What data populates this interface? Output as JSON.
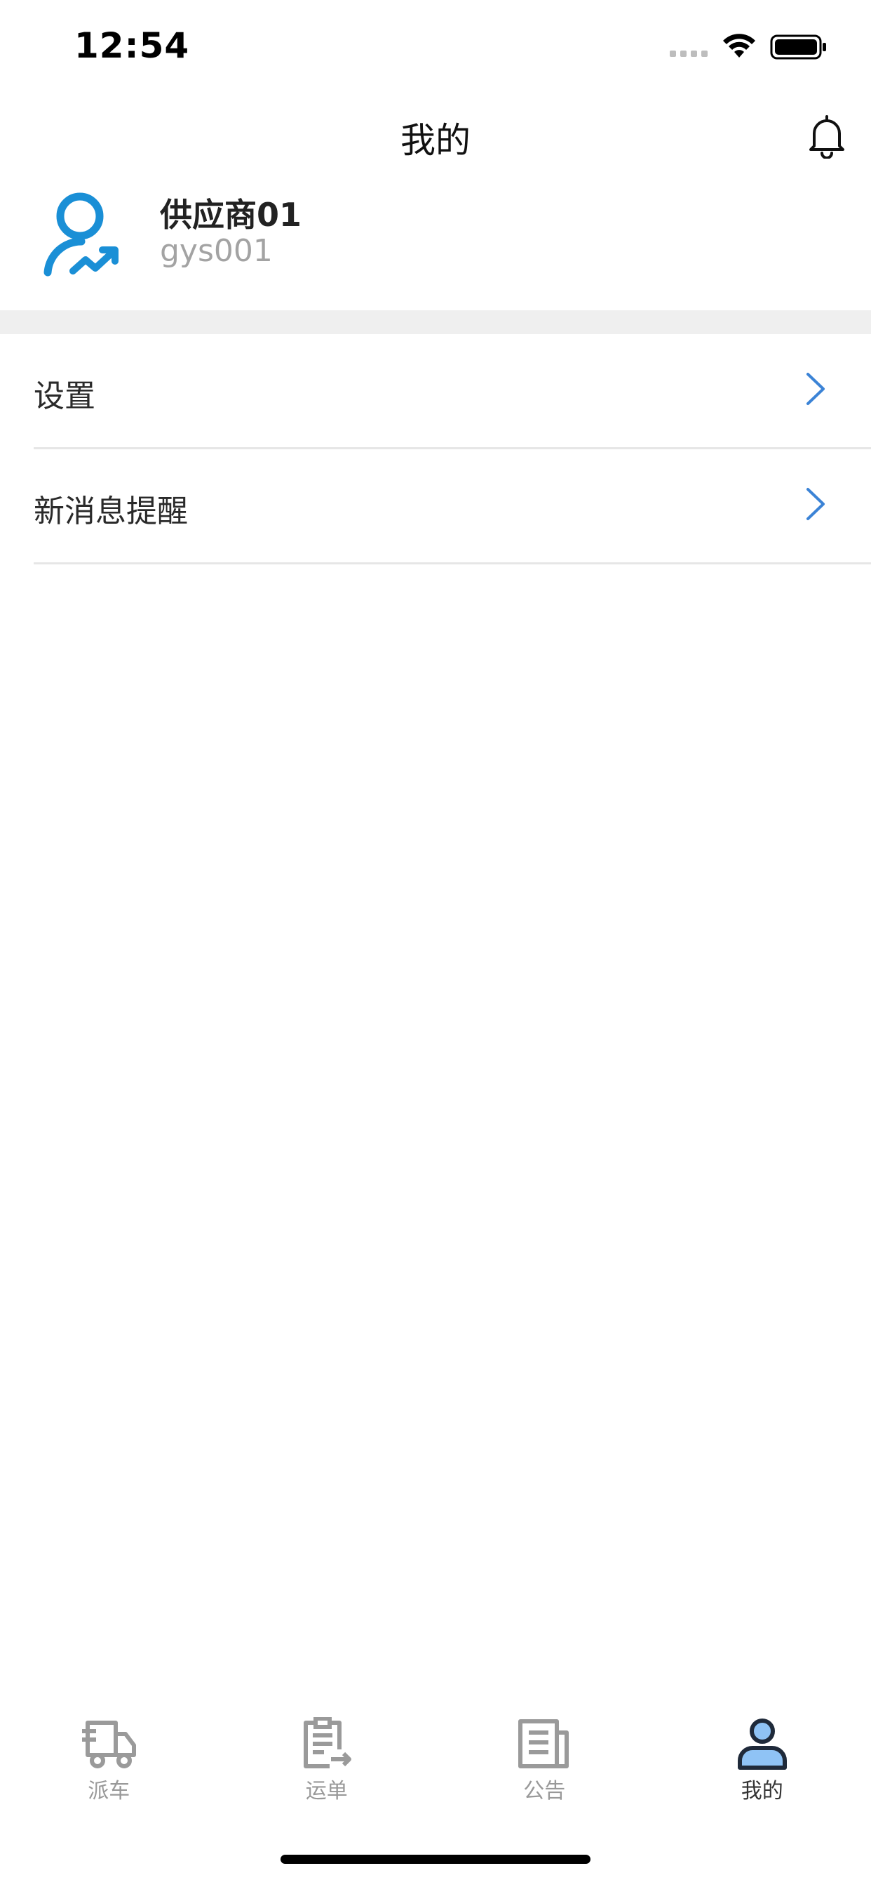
{
  "status_bar": {
    "time": "12:54"
  },
  "header": {
    "title": "我的"
  },
  "profile": {
    "name": "供应商01",
    "account": "gys001"
  },
  "menu": {
    "items": [
      {
        "label": "设置"
      },
      {
        "label": "新消息提醒"
      }
    ]
  },
  "tab_bar": {
    "tabs": [
      {
        "label": "派车",
        "icon": "truck-icon",
        "active": false
      },
      {
        "label": "运单",
        "icon": "waybill-icon",
        "active": false
      },
      {
        "label": "公告",
        "icon": "notice-icon",
        "active": false
      },
      {
        "label": "我的",
        "icon": "user-icon",
        "active": true
      }
    ]
  },
  "colors": {
    "accent": "#1a8fd6",
    "chevron": "#3b83d6",
    "tab_inactive": "#999999",
    "tab_active": "#333333",
    "tab_active_fill": "#8fc3f5",
    "section_gap": "#efefef"
  }
}
